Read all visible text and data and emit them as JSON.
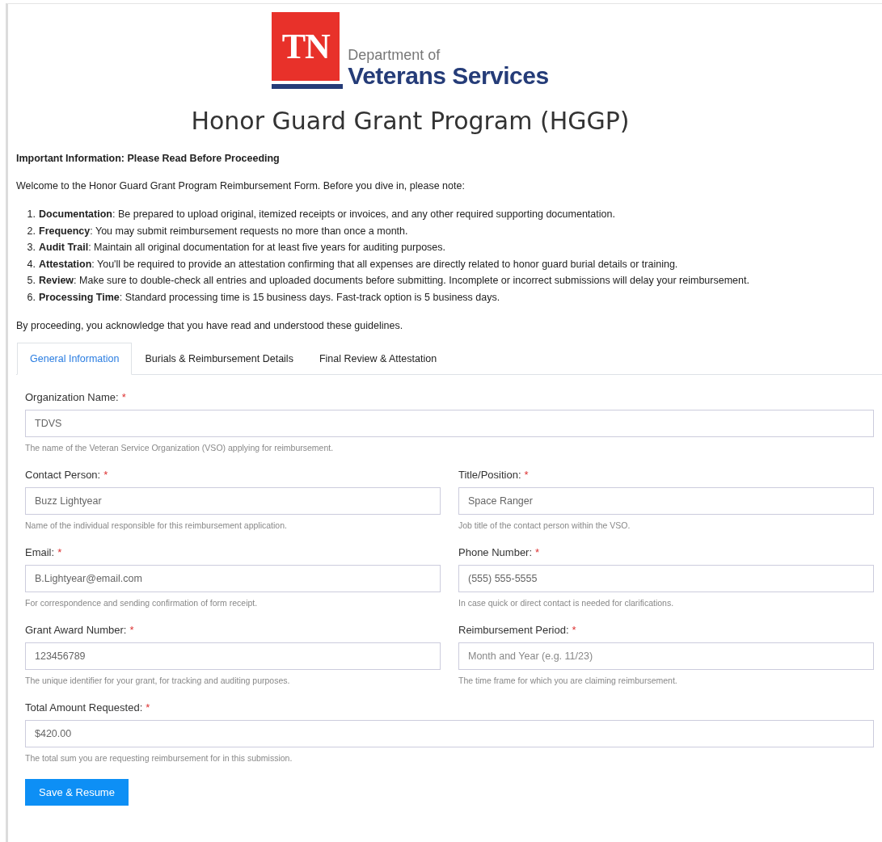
{
  "logo": {
    "mark": "TN",
    "line_1": "Department of",
    "line_2": "Veterans Services"
  },
  "title": "Honor Guard Grant Program (HGGP)",
  "notice": {
    "heading": "Important Information: Please Read Before Proceeding",
    "intro": "Welcome to the Honor Guard Grant Program Reimbursement Form. Before you dive in, please note:",
    "items": [
      {
        "number": "1.",
        "text": "**Documentation**: Be prepared to upload original, itemized receipts or invoices, and any other required supporting documentation."
      },
      {
        "number": "2.",
        "text": "**Frequency**: You may submit reimbursement requests no more than once a month."
      },
      {
        "number": "3.",
        "text": "**Audit Trail**: Maintain all original documentation for at least five years for auditing purposes."
      },
      {
        "number": "4.",
        "text": "**Attestation**: You'll be required to provide an attestation confirming that all expenses are directly related to honor guard burial details or training."
      },
      {
        "number": "5.",
        "text": "**Review**: Make sure to double-check all entries and uploaded documents before submitting. Incomplete or incorrect submissions will delay your reimbursement."
      },
      {
        "number": "6.",
        "text": "**Processing Time**: Standard processing time is 15 business days. Fast-track option is 5 business days."
      }
    ],
    "closing": "By proceeding, you acknowledge that you have read and understood these guidelines."
  },
  "tabs": [
    {
      "label": "General Information",
      "selected": true
    },
    {
      "label": "Burials & Reimbursement Details",
      "selected": false
    },
    {
      "label": "Final Review & Attestation",
      "selected": false
    }
  ],
  "form_rows": [
    [
      {
        "label": "Organization Name:",
        "required_mark": "*",
        "value": "TDVS",
        "help": "The name of the Veteran Service Organization (VSO) applying for reimbursement."
      }
    ],
    [
      {
        "label": "Contact Person:",
        "required_mark": "*",
        "value": "Buzz Lightyear",
        "help": "Name of the individual responsible for this reimbursement application."
      },
      {
        "label": "Title/Position:",
        "required_mark": "*",
        "value": "Space Ranger",
        "help": "Job title of the contact person within the VSO."
      }
    ],
    [
      {
        "label": "Email:",
        "required_mark": "*",
        "value": "B.Lightyear@email.com",
        "help": "For correspondence and sending confirmation of form receipt."
      },
      {
        "label": "Phone Number:",
        "required_mark": "*",
        "value": "(555) 555-5555",
        "help": "In case quick or direct contact is needed for clarifications."
      }
    ],
    [
      {
        "label": "Grant Award Number:",
        "required_mark": "*",
        "value": "123456789",
        "help": "The unique identifier for your grant, for tracking and auditing purposes."
      },
      {
        "label": "Reimbursement Period:",
        "required_mark": "*",
        "placeholder": "Month and Year (e.g. 11/23)",
        "help": "The time frame for which you are claiming reimbursement."
      }
    ],
    [
      {
        "label": "Total Amount Requested:",
        "required_mark": "*",
        "value": "$420.00",
        "help": "The total sum you are requesting reimbursement for in this submission."
      }
    ]
  ],
  "buttons": [
    {
      "label": "Save & Resume"
    }
  ]
}
